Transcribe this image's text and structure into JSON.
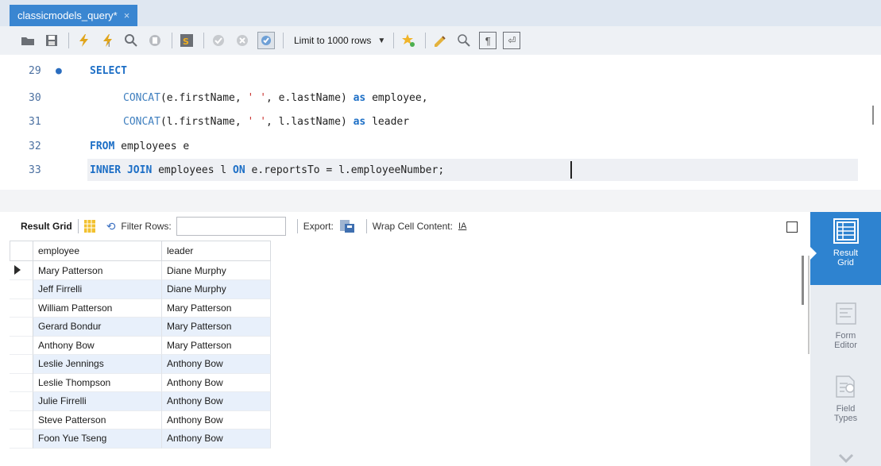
{
  "tab": {
    "title": "classicmodels_query*",
    "close": "×"
  },
  "toolbar": {
    "limit_label": "Limit to 1000 rows"
  },
  "editor": {
    "lines": [
      {
        "num": "29",
        "text": "SELECT"
      },
      {
        "num": "30",
        "text": "CONCAT(e.firstName, ' ', e.lastName) as employee,"
      },
      {
        "num": "31",
        "text": "CONCAT(l.firstName, ' ', l.lastName) as leader"
      },
      {
        "num": "32",
        "text": "FROM employees e"
      },
      {
        "num": "33",
        "text": "INNER JOIN employees l ON e.reportsTo = l.employeeNumber;"
      }
    ]
  },
  "result_toolbar": {
    "result_grid": "Result Grid",
    "filter_rows": "Filter Rows:",
    "export": "Export:",
    "wrap": "Wrap Cell Content:"
  },
  "grid": {
    "columns": [
      "employee",
      "leader"
    ],
    "rows": [
      [
        "Mary Patterson",
        "Diane Murphy"
      ],
      [
        "Jeff Firrelli",
        "Diane Murphy"
      ],
      [
        "William Patterson",
        "Mary Patterson"
      ],
      [
        "Gerard Bondur",
        "Mary Patterson"
      ],
      [
        "Anthony Bow",
        "Mary Patterson"
      ],
      [
        "Leslie Jennings",
        "Anthony Bow"
      ],
      [
        "Leslie Thompson",
        "Anthony Bow"
      ],
      [
        "Julie Firrelli",
        "Anthony Bow"
      ],
      [
        "Steve Patterson",
        "Anthony Bow"
      ],
      [
        "Foon Yue Tseng",
        "Anthony Bow"
      ]
    ]
  },
  "side_panel": {
    "result_grid": "Result Grid",
    "form_editor": "Form Editor",
    "field_types": "Field Types"
  },
  "colors": {
    "tab_accent": "#3a86d1",
    "keyword": "#1d6fc6",
    "string": "#c9302c",
    "panel_active": "#2e83d0"
  }
}
